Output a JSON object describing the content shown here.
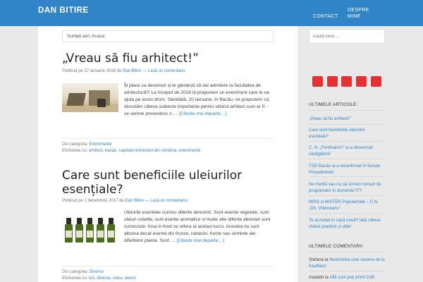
{
  "header": {
    "site_title": "DAN BITIRE",
    "nav": {
      "contact": "CONTACT",
      "despre": "DESPRE MINE"
    }
  },
  "breadcrumb": "Sunteţi aici: Acasa",
  "posts": [
    {
      "title": "„Vreau să fiu arhitect!”",
      "meta_prefix": "Publicat pe 17 ianuarie 2018 de",
      "author": "Dan Bitire",
      "meta_sep": "—",
      "comment_link": "Lasă un comentariu",
      "excerpt": "Îți place sa desenezi și te gândești să dai admitere la facultatea de arhitectură?! La început de 2018 îți propunem un eveniment care te va ajuta pe acest drum. Sâmbătă, 20 ianuarie, în Bacău, ne propunem să discutăm câteva subiecte importante pentru viitorul arhitect cum ar fi: - ce semne prevestesc o …",
      "read_more": "[Citește mai departe…]",
      "category_label": "Din categoria:",
      "category": "Evenimente",
      "tags_label": "Etichetate cu:",
      "tags": "arhitect, bacău, capitala tineretului din românia, evenimente"
    },
    {
      "title": "Care sunt beneficiile uleiurilor esențiale?",
      "meta_prefix": "Publicat pe 1 decembrie 2017 de",
      "author": "Dan Bitire",
      "meta_sep": "—",
      "comment_link": "Lasă un comentariu",
      "excerpt": "Uleiurile esentiale cunosc diferite denumiri. Sunt esente vegetale, sunt uleiuri volatile, sunt esente aromatice si multe alte diferite abordari sunt cunoscute. Insa in fond se refera la acelasi lucru. Acestea nu sunt altceva decat esenta din frunze, radacini, fructe sau seminte ale diferitelor plante. Sunt …",
      "read_more": "[Citește mai departe…]",
      "category_label": "Din categoria:",
      "category": "Diverse",
      "tags_label": "Etichetate cu:",
      "tags": "bio, diverse, natur, uleiuri"
    }
  ],
  "sidebar": {
    "search_placeholder": "Caută ceva …",
    "social_color": "#e63131",
    "articles_heading": "ULTIMELE ARTICOLE:",
    "articles": [
      "„Vreau să fiu arhitect!”",
      "Care sunt beneficiile uleiurilor esențiale?",
      "C. N. „Ferdinand I” și-a desemnat câștigătorii!",
      "TSD Bacău și-a reconfirmat în funcție Președintele!",
      "Se merită sau nu să urmezi cursuri de programare în domeniul IT?",
      "MISS și MISTER Popularitate – C.N. „Gh. Vrânceanu”",
      "Te-ai mutat în casă nouă? Iată câteva sfaturi practice și utile!"
    ],
    "comments_heading": "ULTIMELE COMENTARII:",
    "comments": [
      {
        "author": "Ștefana",
        "on": "la",
        "post": "Nesimțirea unei casiere de la Kaufland"
      },
      {
        "author": "madalin",
        "on": "la",
        "post": "Află cum poți primi 1GB"
      }
    ]
  },
  "colors": {
    "accent": "#2f85c8",
    "social": "#e63131"
  }
}
